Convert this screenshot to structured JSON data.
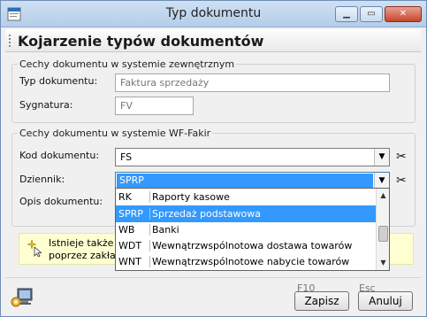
{
  "window": {
    "title": "Typ dokumentu"
  },
  "header": {
    "title": "Kojarzenie typów dokumentów"
  },
  "external_group": {
    "legend": "Cechy dokumentu w systemie zewnętrznym",
    "doc_type_label": "Typ dokumentu:",
    "doc_type_value": "Faktura sprzedaży",
    "signature_label": "Sygnatura:",
    "signature_value": "FV"
  },
  "internal_group": {
    "legend": "Cechy dokumentu w systemie WF-Fakir",
    "doc_code_label": "Kod dokumentu:",
    "doc_code_value": "FS",
    "journal_label": "Dziennik:",
    "journal_value": "SPRP",
    "description_label": "Opis dokumentu:"
  },
  "journal_dropdown": {
    "items": [
      {
        "code": "RK",
        "name": "Raporty kasowe"
      },
      {
        "code": "SPRP",
        "name": "Sprzedaż podstawowa"
      },
      {
        "code": "WB",
        "name": "Banki"
      },
      {
        "code": "WDT",
        "name": "Wewnątrzwspólnotowa dostawa towarów"
      },
      {
        "code": "WNT",
        "name": "Wewnątrzwspólnotowe nabycie towarów"
      }
    ],
    "selected_index": 1
  },
  "info": {
    "line1_left": "Istnieje także n",
    "line1_right": "ka",
    "line2": "poprzez zakład"
  },
  "footer": {
    "save_key": "F10",
    "save_label": "Zapisz",
    "cancel_key": "Esc",
    "cancel_label": "Anuluj"
  },
  "icons": {
    "app": "document-app-icon",
    "scissors": "scissors-icon",
    "info": "wizard-star-icon",
    "status": "computer-settings-icon"
  },
  "colors": {
    "selection": "#3399ff",
    "info_background": "#ffffd2",
    "title_bar": "#c4d8ef"
  }
}
